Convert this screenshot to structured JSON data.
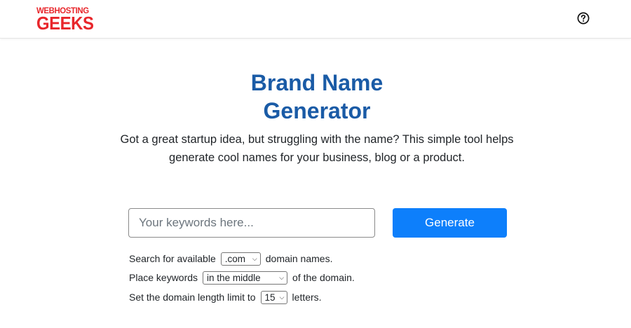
{
  "header": {
    "logo_line1": "WEBHOSTING",
    "logo_line2": "GEEKS",
    "help_icon": "question-circle-icon",
    "brand_color": "#e8262b"
  },
  "main": {
    "title_line1": "Brand Name",
    "title_line2": "Generator",
    "subtitle": "Got a great startup idea, but struggling with the name? This simple tool helps generate cool names for your business, blog or a product.",
    "title_color": "#1a5ba6"
  },
  "form": {
    "keywords_placeholder": "Your keywords here...",
    "keywords_value": "",
    "generate_label": "Generate",
    "button_color": "#0d7ffb"
  },
  "options": {
    "tld_prefix": "Search for available",
    "tld_selected": ".com",
    "tld_suffix": "domain names.",
    "placement_prefix": "Place keywords",
    "placement_selected": "in the middle",
    "placement_suffix": "of the domain.",
    "length_prefix": "Set the domain length limit to",
    "length_selected": "15",
    "length_suffix": "letters."
  }
}
